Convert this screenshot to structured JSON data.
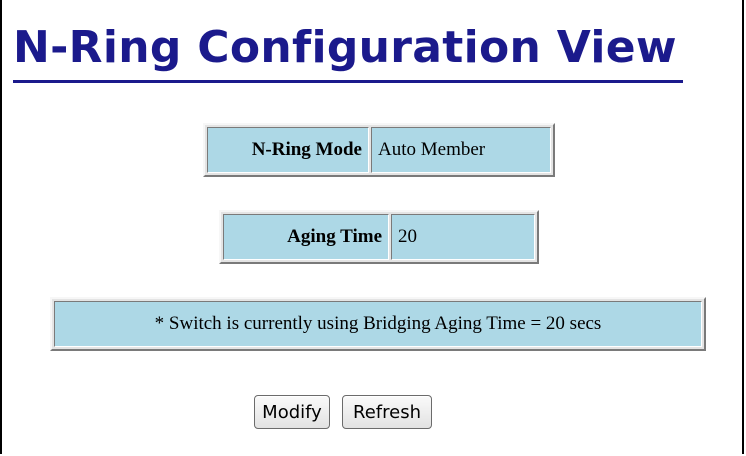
{
  "page": {
    "title": "N-Ring Configuration View"
  },
  "mode": {
    "label": "N-Ring Mode",
    "value": "Auto Member"
  },
  "aging": {
    "label": "Aging Time",
    "value": "20"
  },
  "note": {
    "text": "* Switch is currently using Bridging Aging Time = 20 secs"
  },
  "buttons": {
    "modify_label": "Modify",
    "refresh_label": "Refresh"
  },
  "colors": {
    "title": "#1b1a8c",
    "cell_background": "#add8e6",
    "page_background": "#ffffff"
  }
}
